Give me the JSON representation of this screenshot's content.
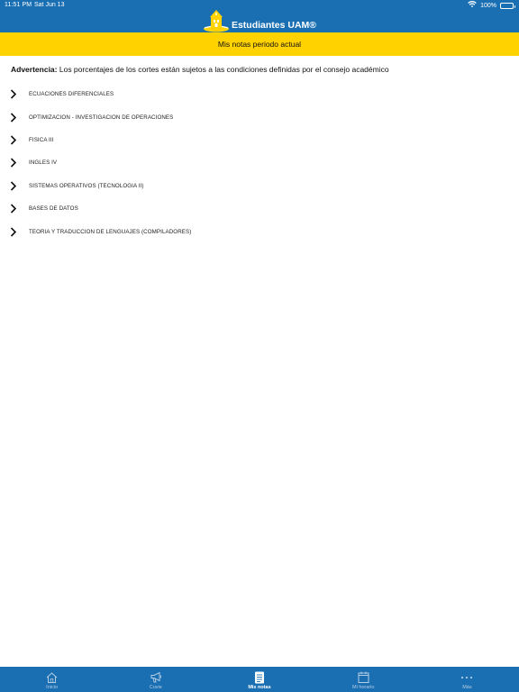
{
  "status_bar": {
    "time": "11:51 PM",
    "date": "Sat Jun 13",
    "battery": "100%",
    "wifi_icon": "wifi-icon",
    "battery_icon": "battery-icon"
  },
  "header": {
    "app_title": "Estudiantes UAM®",
    "logo_icon": "university-building-logo"
  },
  "subtitle": "Mis notas periodo actual",
  "warning": {
    "label": "Advertencia:",
    "text": " Los porcentajes de los cortes están sujetos a las condiciones definidas por el consejo académico"
  },
  "courses": [
    {
      "name": "ECUACIONES DIFERENCIALES"
    },
    {
      "name": "OPTIMIZACION - INVESTIGACION DE OPERACIONES"
    },
    {
      "name": "FISICA III"
    },
    {
      "name": "INGLES IV"
    },
    {
      "name": "SISTEMAS OPERATIVOS (TECNOLOGIA II)"
    },
    {
      "name": "BASES DE DATOS"
    },
    {
      "name": "TEORIA Y TRADUCCION DE LENGUAJES (COMPILADORES)"
    }
  ],
  "tabbar": {
    "items": [
      {
        "label": "Inicio",
        "icon": "home-icon"
      },
      {
        "label": "Cuvie",
        "icon": "megaphone-icon"
      },
      {
        "label": "Mis notas",
        "icon": "document-icon",
        "active": true
      },
      {
        "label": "Mi horario",
        "icon": "calendar-icon"
      },
      {
        "label": "Más",
        "icon": "more-dots-icon"
      }
    ]
  },
  "colors": {
    "header_blue": "#1a6fb3",
    "accent_yellow": "#ffd200",
    "tab_inactive": "#b5cde3",
    "tab_active": "#ffffff"
  }
}
